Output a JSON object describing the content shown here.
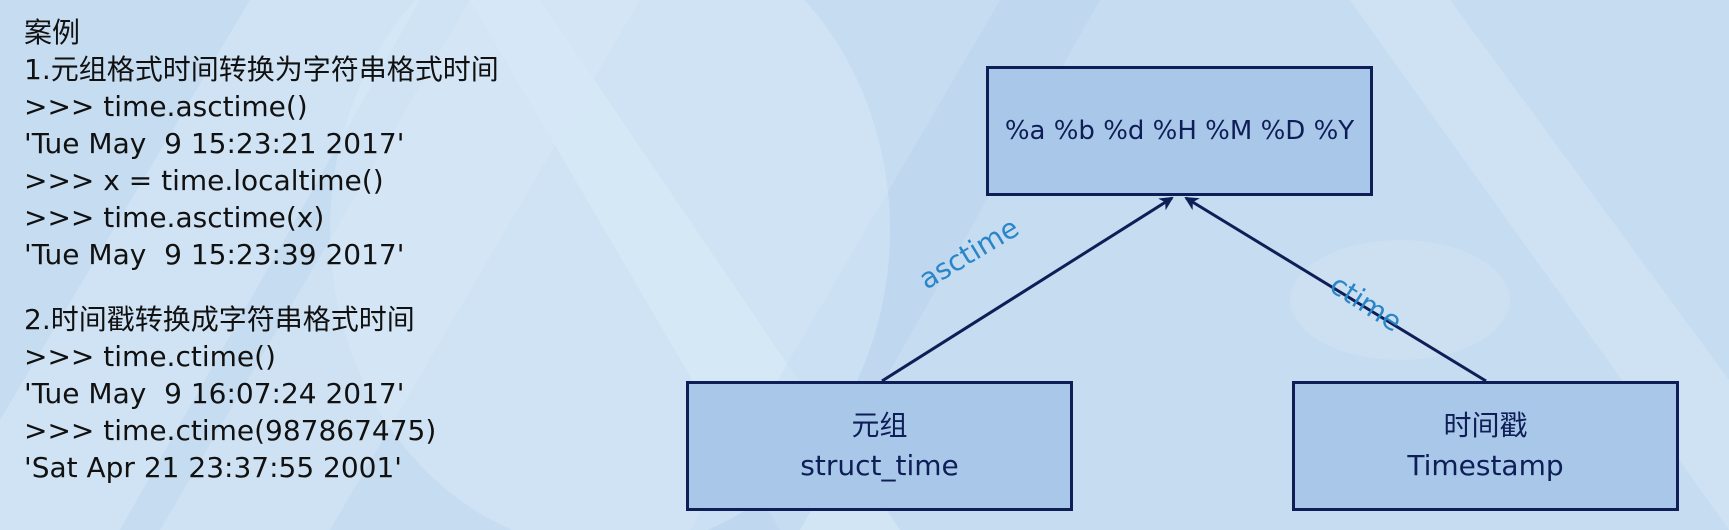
{
  "left_panel": {
    "heading": "案例",
    "section1_title": "1.元组格式时间转换为字符串格式时间",
    "section1_lines": [
      ">>> time.asctime()",
      "'Tue May  9 15:23:21 2017'",
      ">>> x = time.localtime()",
      ">>> time.asctime(x)",
      "'Tue May  9 15:23:39 2017'"
    ],
    "section2_title": "2.时间戳转换成字符串格式时间",
    "section2_lines": [
      ">>> time.ctime()",
      "'Tue May  9 16:07:24 2017'",
      ">>> time.ctime(987867475)",
      "'Sat Apr 21 23:37:55 2001'"
    ]
  },
  "diagram": {
    "format_box": "%a %b %d %H %M %D %Y",
    "struct_box": {
      "line1": "元组",
      "line2": "struct_time"
    },
    "timestamp_box": {
      "line1": "时间戳",
      "line2": "Timestamp"
    },
    "edge_asctime": "asctime",
    "edge_ctime": "ctime"
  },
  "colors": {
    "background": "#c6dcf0",
    "box_fill": "#a9c8e9",
    "box_border": "#0e1e56",
    "edge_label": "#2a86c8",
    "text": "#111111"
  }
}
